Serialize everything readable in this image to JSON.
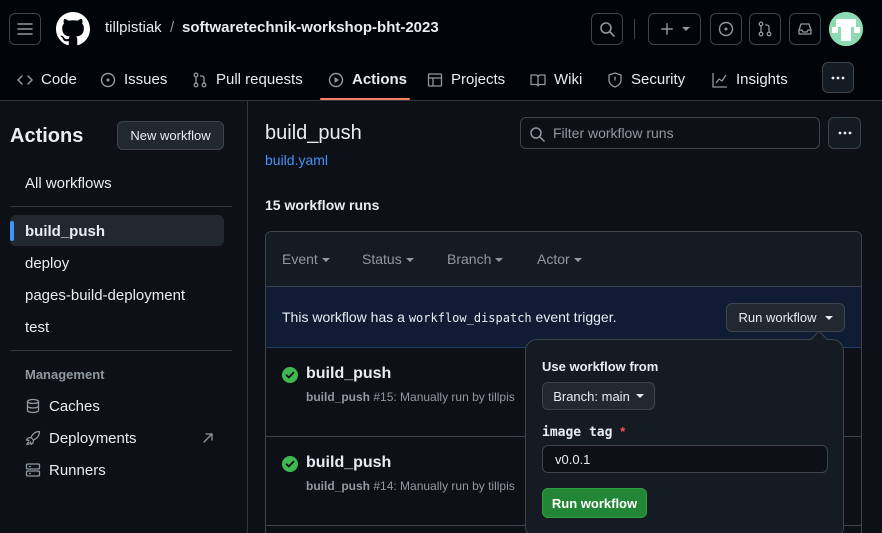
{
  "colors": {
    "accent": "#4493f8",
    "success": "#3fb950",
    "primary_button": "#238636",
    "tab_underline": "#f78166",
    "required": "#f85149"
  },
  "header": {
    "owner": "tillpistiak",
    "separator": "/",
    "repo": "softwaretechnik-workshop-bht-2023",
    "icons": [
      "menu-icon",
      "github-logo-icon",
      "search-icon",
      "plus-icon",
      "issue-icon",
      "pull-request-icon",
      "inbox-icon",
      "avatar"
    ]
  },
  "tabs": [
    {
      "label": "Code",
      "icon": "code-icon"
    },
    {
      "label": "Issues",
      "icon": "issue-icon"
    },
    {
      "label": "Pull requests",
      "icon": "pull-request-icon"
    },
    {
      "label": "Actions",
      "icon": "play-icon",
      "active": true
    },
    {
      "label": "Projects",
      "icon": "table-icon"
    },
    {
      "label": "Wiki",
      "icon": "book-icon"
    },
    {
      "label": "Security",
      "icon": "shield-icon"
    },
    {
      "label": "Insights",
      "icon": "graph-icon"
    }
  ],
  "sidebar": {
    "title": "Actions",
    "new_workflow": "New workflow",
    "all_workflows": "All workflows",
    "workflows": [
      "build_push",
      "deploy",
      "pages-build-deployment",
      "test"
    ],
    "selected": "build_push",
    "management_label": "Management",
    "management": [
      {
        "label": "Caches",
        "icon": "database-icon"
      },
      {
        "label": "Deployments",
        "icon": "rocket-icon"
      },
      {
        "label": "Runners",
        "icon": "server-icon"
      }
    ]
  },
  "main": {
    "title": "build_push",
    "file": "build.yaml",
    "filter_placeholder": "Filter workflow runs",
    "runs_count": "15 workflow runs",
    "filters": [
      "Event",
      "Status",
      "Branch",
      "Actor"
    ],
    "dispatch": {
      "prefix": "This workflow has a",
      "code": "workflow_dispatch",
      "suffix": "event trigger."
    },
    "run_workflow_button": "Run workflow",
    "runs": [
      {
        "name": "build_push",
        "workflow": "build_push",
        "number": "#15",
        "desc": ": Manually run by tillpis"
      },
      {
        "name": "build_push",
        "workflow": "build_push",
        "number": "#14",
        "desc": ": Manually run by tillpis"
      }
    ]
  },
  "popover": {
    "heading": "Use workflow from",
    "branch": "Branch: main",
    "input_label": "image tag",
    "required_mark": "*",
    "input_value": "v0.0.1",
    "submit": "Run workflow"
  }
}
